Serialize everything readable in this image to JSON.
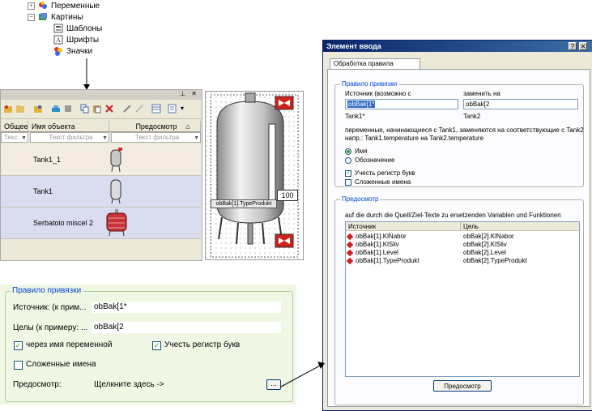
{
  "tree": {
    "items": [
      {
        "label": "Переменные"
      },
      {
        "label": "Картины"
      },
      {
        "label": "Шаблоны"
      },
      {
        "label": "Шрифты"
      },
      {
        "label": "Значки"
      }
    ]
  },
  "objects_panel": {
    "columns": [
      "Общее",
      "Имя объекта",
      "Предосмотр"
    ],
    "filters": [
      "Текс",
      "Текст фильтра",
      "Текст фильтра"
    ],
    "rows": [
      {
        "name": "Tank1_1"
      },
      {
        "name": "Tank1"
      },
      {
        "name": "Serbatoio miscel 2"
      }
    ]
  },
  "tank_view": {
    "tag_text": "obBak[1].TypeProdukt",
    "level_value": "100"
  },
  "dialog": {
    "title": "Элемент ввода",
    "tab": "Обработка правила привязки",
    "rule_group": "Правило привязки",
    "source_label": "Источник (возможно с",
    "replace_label": "заменить на",
    "source_value": "obBak[1*",
    "replace_value": "obBak[2",
    "source_hint": "Tank1*",
    "replace_hint": "Tank2",
    "desc_line1": "переменные, начинающиеся с Tank1, заменяются на соответствующие с Tank2",
    "desc_line2": "напр.: Tank1.temperature на Tank2.temperature",
    "radio_name": "Имя",
    "radio_designation": "Обозначение",
    "check_case": "Учесть регистр букв",
    "check_compound": "Сложенные имена",
    "preview_group": "Предосмотр",
    "preview_desc": "auf die durch die Quell/Ziel-Texte zu ersetzenden Variablen und Funktionen",
    "list_headers": [
      "Источник",
      "Цель"
    ],
    "list_rows": [
      {
        "src": "obBak[1].KlNabor",
        "dst": "obBak[2].KlNabor"
      },
      {
        "src": "obBak[1].KlSliv",
        "dst": "obBak[2].KlSliv"
      },
      {
        "src": "obBak[1].Level",
        "dst": "obBak[2].Level"
      },
      {
        "src": "obBak[1].TypeProdukt",
        "dst": "obBak[2].TypeProdukt"
      }
    ],
    "preview_button": "Предосмотр"
  },
  "rule_panel": {
    "title": "Правило привязки",
    "source_label": "Источник: (к прим...",
    "source_value": "obBak[1*",
    "target_label": "Целы (к примеру: ...",
    "target_value": "obBak[2",
    "check_var_name": "через имя переменной",
    "check_case": "Учесть регистр букв",
    "check_compound": "Сложенные имена",
    "preview_label": "Предосмотр:",
    "preview_hint": "Щелкните здесь ->",
    "browse_button": "..."
  },
  "colors": {
    "accent_blue": "#0046d5",
    "check_green": "#21a121",
    "title_bar": "#0a246a",
    "grid_row_a": "#f4ece2",
    "grid_row_b": "#dadcf0",
    "alarm_red": "#d0201a"
  }
}
